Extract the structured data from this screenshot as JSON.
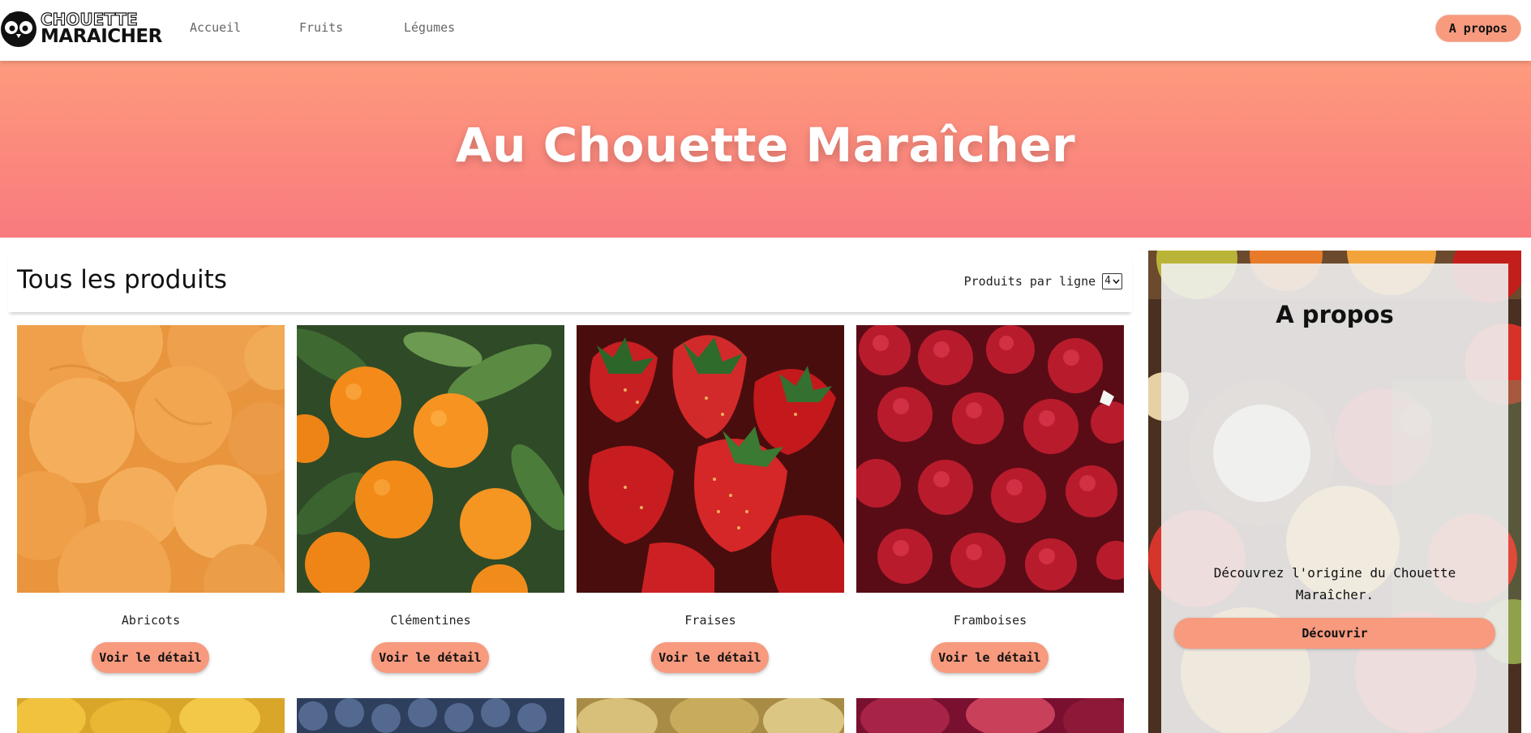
{
  "header": {
    "logo_line1": "CHOUETTE",
    "logo_line2": "MARAICHER",
    "nav": [
      {
        "label": "Accueil"
      },
      {
        "label": "Fruits"
      },
      {
        "label": "Légumes"
      }
    ],
    "about_button": "A propos"
  },
  "hero": {
    "title": "Au Chouette Maraîcher"
  },
  "products": {
    "title": "Tous les produits",
    "per_line_label": "Produits par ligne",
    "per_line_value": "4",
    "items": [
      {
        "name": "Abricots",
        "button": "Voir le détail",
        "image": "apricots-photo"
      },
      {
        "name": "Clémentines",
        "button": "Voir le détail",
        "image": "clementines-photo"
      },
      {
        "name": "Fraises",
        "button": "Voir le détail",
        "image": "strawberries-photo"
      },
      {
        "name": "Framboises",
        "button": "Voir le détail",
        "image": "raspberries-photo"
      }
    ],
    "next_row_images": [
      "lemons-photo",
      "blueberries-photo",
      "pears-photo",
      "plums-photo"
    ]
  },
  "aside": {
    "title": "A propos",
    "text": "Découvrez l'origine du Chouette Maraîcher.",
    "button": "Découvrir",
    "image": "fruit-table-photo"
  },
  "colors": {
    "accent": "#f79a7e",
    "hero_top": "#fe9b7d",
    "hero_bottom": "#f87a7e"
  }
}
